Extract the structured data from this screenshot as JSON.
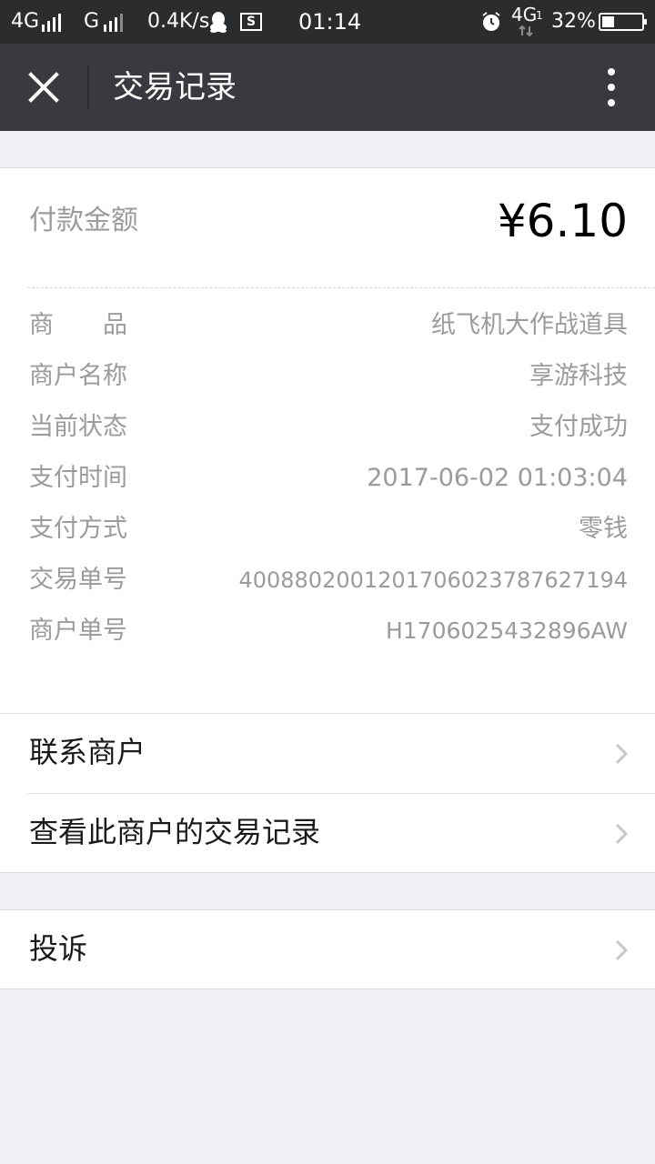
{
  "status_bar": {
    "network1": "4G",
    "network2": "G",
    "speed": "0.4K/s",
    "screenshot_glyph": "S",
    "time": "01:14",
    "network3": "4G",
    "network3_sub": "1",
    "battery": "32%",
    "battery_level": 0.32,
    "icons": [
      "signal-icon",
      "qq-icon",
      "screenshot-icon",
      "alarm-icon",
      "network-icon",
      "battery-icon"
    ]
  },
  "nav": {
    "title": "交易记录",
    "close_icon": "close-icon",
    "more_icon": "more-vertical-icon"
  },
  "payment": {
    "amount_label": "付款金额",
    "amount": "¥6.10",
    "details": [
      {
        "key": "商　　品",
        "value": "纸飞机大作战道具"
      },
      {
        "key": "商户名称",
        "value": "享游科技"
      },
      {
        "key": "当前状态",
        "value": "支付成功"
      },
      {
        "key": "支付时间",
        "value": "2017-06-02 01:03:04"
      },
      {
        "key": "支付方式",
        "value": "零钱"
      },
      {
        "key": "交易单号",
        "value": "4008802001201706023787627194"
      },
      {
        "key": "商户单号",
        "value": "H1706025432896AW"
      }
    ]
  },
  "actions": {
    "contact": "联系商户",
    "history": "查看此商户的交易记录",
    "complain": "投诉",
    "chevron_icon": "chevron-right-icon"
  },
  "colors": {
    "status_bar_bg": "#2b2c2e",
    "nav_bg": "#393a3f",
    "page_bg": "#efeff4",
    "secondary_text": "#9b9b9b"
  }
}
